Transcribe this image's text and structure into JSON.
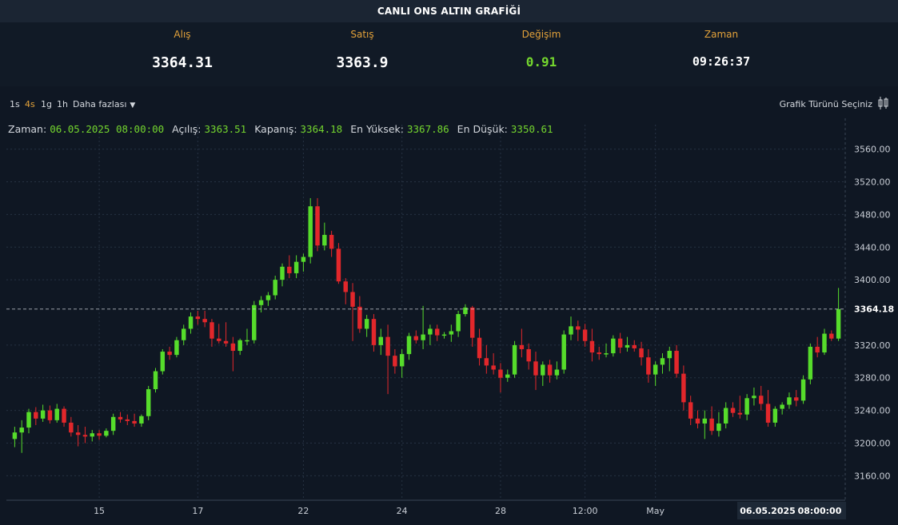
{
  "page": {
    "title": "CANLI ONS ALTIN GRAFİĞİ"
  },
  "quotes": {
    "bid_label": "Alış",
    "bid_value": "3364.31",
    "ask_label": "Satış",
    "ask_value": "3363.9",
    "change_label": "Değişim",
    "change_value": "0.91",
    "time_label": "Zaman",
    "time_value": "09:26:37"
  },
  "toolbar": {
    "timeframes": [
      "1s",
      "4s",
      "1g",
      "1h"
    ],
    "active_timeframe": "4s",
    "more_label": "Daha fazlası",
    "chart_type_label": "Grafik Türünü Seçiniz"
  },
  "ohlc": {
    "time_label": "Zaman:",
    "time_value": "06.05.2025 08:00:00",
    "open_label": "Açılış:",
    "open_value": "3363.51",
    "close_label": "Kapanış:",
    "close_value": "3364.18",
    "high_label": "En Yüksek:",
    "high_value": "3367.86",
    "low_label": "En Düşük:",
    "low_value": "3350.61"
  },
  "colors": {
    "up": "#56dc2b",
    "down": "#e2272b",
    "label_accent": "#e3a23a",
    "value_green": "#74d62e",
    "background": "#0f1723"
  },
  "chart_data": {
    "type": "candlestick",
    "y_ticks": [
      3160,
      3200,
      3240,
      3280,
      3320,
      3360,
      3400,
      3440,
      3480,
      3520,
      3560
    ],
    "y_tick_labels": [
      "3160.00",
      "3200.00",
      "3240.00",
      "3280.00",
      "3320.00",
      "3364.18",
      "3400.00",
      "3440.00",
      "3480.00",
      "3520.00",
      "3560.00"
    ],
    "ylim": [
      3130,
      3590
    ],
    "last_price": 3364.18,
    "last_price_label": "3364.18",
    "x_labels": [
      {
        "label": "15",
        "index": 12
      },
      {
        "label": "17",
        "index": 26
      },
      {
        "label": "22",
        "index": 41
      },
      {
        "label": "24",
        "index": 55
      },
      {
        "label": "28",
        "index": 69
      },
      {
        "label": "12:00",
        "index": 81
      },
      {
        "label": "May",
        "index": 91
      }
    ],
    "crosshair_date": "06.05.2025",
    "crosshair_time": "08:00:00",
    "grid": true,
    "candles": [
      {
        "o": 3205,
        "h": 3220,
        "l": 3195,
        "c": 3213
      },
      {
        "o": 3213,
        "h": 3228,
        "l": 3188,
        "c": 3219
      },
      {
        "o": 3219,
        "h": 3242,
        "l": 3212,
        "c": 3238
      },
      {
        "o": 3238,
        "h": 3244,
        "l": 3222,
        "c": 3230
      },
      {
        "o": 3230,
        "h": 3247,
        "l": 3226,
        "c": 3240
      },
      {
        "o": 3240,
        "h": 3246,
        "l": 3224,
        "c": 3228
      },
      {
        "o": 3228,
        "h": 3248,
        "l": 3225,
        "c": 3242
      },
      {
        "o": 3242,
        "h": 3245,
        "l": 3220,
        "c": 3225
      },
      {
        "o": 3225,
        "h": 3232,
        "l": 3208,
        "c": 3213
      },
      {
        "o": 3213,
        "h": 3222,
        "l": 3196,
        "c": 3210
      },
      {
        "o": 3210,
        "h": 3220,
        "l": 3200,
        "c": 3208
      },
      {
        "o": 3208,
        "h": 3216,
        "l": 3202,
        "c": 3212
      },
      {
        "o": 3212,
        "h": 3216,
        "l": 3204,
        "c": 3209
      },
      {
        "o": 3209,
        "h": 3218,
        "l": 3207,
        "c": 3215
      },
      {
        "o": 3215,
        "h": 3236,
        "l": 3210,
        "c": 3232
      },
      {
        "o": 3232,
        "h": 3238,
        "l": 3225,
        "c": 3229
      },
      {
        "o": 3229,
        "h": 3235,
        "l": 3222,
        "c": 3227
      },
      {
        "o": 3227,
        "h": 3236,
        "l": 3220,
        "c": 3224
      },
      {
        "o": 3224,
        "h": 3235,
        "l": 3220,
        "c": 3233
      },
      {
        "o": 3233,
        "h": 3270,
        "l": 3228,
        "c": 3266
      },
      {
        "o": 3266,
        "h": 3292,
        "l": 3262,
        "c": 3288
      },
      {
        "o": 3288,
        "h": 3315,
        "l": 3284,
        "c": 3312
      },
      {
        "o": 3312,
        "h": 3318,
        "l": 3302,
        "c": 3308
      },
      {
        "o": 3308,
        "h": 3330,
        "l": 3305,
        "c": 3326
      },
      {
        "o": 3326,
        "h": 3345,
        "l": 3320,
        "c": 3340
      },
      {
        "o": 3340,
        "h": 3360,
        "l": 3334,
        "c": 3355
      },
      {
        "o": 3355,
        "h": 3362,
        "l": 3345,
        "c": 3352
      },
      {
        "o": 3352,
        "h": 3362,
        "l": 3342,
        "c": 3348
      },
      {
        "o": 3348,
        "h": 3352,
        "l": 3318,
        "c": 3328
      },
      {
        "o": 3328,
        "h": 3346,
        "l": 3322,
        "c": 3325
      },
      {
        "o": 3325,
        "h": 3348,
        "l": 3318,
        "c": 3322
      },
      {
        "o": 3322,
        "h": 3330,
        "l": 3288,
        "c": 3313
      },
      {
        "o": 3313,
        "h": 3328,
        "l": 3308,
        "c": 3326
      },
      {
        "o": 3326,
        "h": 3340,
        "l": 3320,
        "c": 3326
      },
      {
        "o": 3326,
        "h": 3374,
        "l": 3322,
        "c": 3369
      },
      {
        "o": 3369,
        "h": 3380,
        "l": 3360,
        "c": 3375
      },
      {
        "o": 3375,
        "h": 3385,
        "l": 3368,
        "c": 3381
      },
      {
        "o": 3381,
        "h": 3405,
        "l": 3376,
        "c": 3400
      },
      {
        "o": 3400,
        "h": 3420,
        "l": 3392,
        "c": 3416
      },
      {
        "o": 3416,
        "h": 3430,
        "l": 3402,
        "c": 3408
      },
      {
        "o": 3408,
        "h": 3430,
        "l": 3402,
        "c": 3422
      },
      {
        "o": 3422,
        "h": 3432,
        "l": 3410,
        "c": 3428
      },
      {
        "o": 3428,
        "h": 3500,
        "l": 3420,
        "c": 3490
      },
      {
        "o": 3490,
        "h": 3500,
        "l": 3435,
        "c": 3442
      },
      {
        "o": 3442,
        "h": 3470,
        "l": 3436,
        "c": 3455
      },
      {
        "o": 3455,
        "h": 3460,
        "l": 3428,
        "c": 3438
      },
      {
        "o": 3438,
        "h": 3445,
        "l": 3395,
        "c": 3398
      },
      {
        "o": 3398,
        "h": 3402,
        "l": 3370,
        "c": 3385
      },
      {
        "o": 3385,
        "h": 3396,
        "l": 3325,
        "c": 3367
      },
      {
        "o": 3367,
        "h": 3380,
        "l": 3335,
        "c": 3340
      },
      {
        "o": 3340,
        "h": 3357,
        "l": 3330,
        "c": 3352
      },
      {
        "o": 3352,
        "h": 3358,
        "l": 3312,
        "c": 3320
      },
      {
        "o": 3320,
        "h": 3340,
        "l": 3308,
        "c": 3330
      },
      {
        "o": 3330,
        "h": 3345,
        "l": 3260,
        "c": 3307
      },
      {
        "o": 3307,
        "h": 3315,
        "l": 3285,
        "c": 3294
      },
      {
        "o": 3294,
        "h": 3315,
        "l": 3280,
        "c": 3309
      },
      {
        "o": 3309,
        "h": 3335,
        "l": 3302,
        "c": 3331
      },
      {
        "o": 3331,
        "h": 3338,
        "l": 3322,
        "c": 3326
      },
      {
        "o": 3326,
        "h": 3368,
        "l": 3315,
        "c": 3333
      },
      {
        "o": 3333,
        "h": 3345,
        "l": 3320,
        "c": 3340
      },
      {
        "o": 3340,
        "h": 3345,
        "l": 3325,
        "c": 3332
      },
      {
        "o": 3332,
        "h": 3336,
        "l": 3328,
        "c": 3333
      },
      {
        "o": 3333,
        "h": 3345,
        "l": 3324,
        "c": 3337
      },
      {
        "o": 3337,
        "h": 3362,
        "l": 3330,
        "c": 3358
      },
      {
        "o": 3358,
        "h": 3370,
        "l": 3355,
        "c": 3366
      },
      {
        "o": 3366,
        "h": 3368,
        "l": 3318,
        "c": 3329
      },
      {
        "o": 3329,
        "h": 3340,
        "l": 3295,
        "c": 3304
      },
      {
        "o": 3304,
        "h": 3320,
        "l": 3285,
        "c": 3295
      },
      {
        "o": 3295,
        "h": 3310,
        "l": 3284,
        "c": 3290
      },
      {
        "o": 3290,
        "h": 3298,
        "l": 3262,
        "c": 3280
      },
      {
        "o": 3280,
        "h": 3290,
        "l": 3275,
        "c": 3284
      },
      {
        "o": 3284,
        "h": 3325,
        "l": 3280,
        "c": 3320
      },
      {
        "o": 3320,
        "h": 3340,
        "l": 3305,
        "c": 3315
      },
      {
        "o": 3315,
        "h": 3322,
        "l": 3290,
        "c": 3300
      },
      {
        "o": 3300,
        "h": 3312,
        "l": 3265,
        "c": 3283
      },
      {
        "o": 3283,
        "h": 3300,
        "l": 3270,
        "c": 3296
      },
      {
        "o": 3296,
        "h": 3302,
        "l": 3274,
        "c": 3283
      },
      {
        "o": 3283,
        "h": 3300,
        "l": 3278,
        "c": 3290
      },
      {
        "o": 3290,
        "h": 3338,
        "l": 3285,
        "c": 3333
      },
      {
        "o": 3333,
        "h": 3355,
        "l": 3326,
        "c": 3343
      },
      {
        "o": 3343,
        "h": 3350,
        "l": 3325,
        "c": 3339
      },
      {
        "o": 3339,
        "h": 3346,
        "l": 3318,
        "c": 3325
      },
      {
        "o": 3325,
        "h": 3340,
        "l": 3300,
        "c": 3311
      },
      {
        "o": 3311,
        "h": 3318,
        "l": 3302,
        "c": 3309
      },
      {
        "o": 3309,
        "h": 3322,
        "l": 3305,
        "c": 3310
      },
      {
        "o": 3310,
        "h": 3332,
        "l": 3306,
        "c": 3328
      },
      {
        "o": 3328,
        "h": 3335,
        "l": 3310,
        "c": 3317
      },
      {
        "o": 3317,
        "h": 3330,
        "l": 3312,
        "c": 3320
      },
      {
        "o": 3320,
        "h": 3326,
        "l": 3312,
        "c": 3316
      },
      {
        "o": 3316,
        "h": 3324,
        "l": 3295,
        "c": 3305
      },
      {
        "o": 3305,
        "h": 3315,
        "l": 3274,
        "c": 3284
      },
      {
        "o": 3284,
        "h": 3300,
        "l": 3270,
        "c": 3296
      },
      {
        "o": 3296,
        "h": 3310,
        "l": 3285,
        "c": 3304
      },
      {
        "o": 3304,
        "h": 3318,
        "l": 3288,
        "c": 3313
      },
      {
        "o": 3313,
        "h": 3320,
        "l": 3280,
        "c": 3285
      },
      {
        "o": 3285,
        "h": 3295,
        "l": 3240,
        "c": 3250
      },
      {
        "o": 3250,
        "h": 3258,
        "l": 3222,
        "c": 3230
      },
      {
        "o": 3230,
        "h": 3240,
        "l": 3218,
        "c": 3224
      },
      {
        "o": 3224,
        "h": 3240,
        "l": 3205,
        "c": 3230
      },
      {
        "o": 3230,
        "h": 3245,
        "l": 3210,
        "c": 3215
      },
      {
        "o": 3215,
        "h": 3238,
        "l": 3208,
        "c": 3224
      },
      {
        "o": 3224,
        "h": 3250,
        "l": 3218,
        "c": 3243
      },
      {
        "o": 3243,
        "h": 3250,
        "l": 3232,
        "c": 3237
      },
      {
        "o": 3237,
        "h": 3258,
        "l": 3230,
        "c": 3235
      },
      {
        "o": 3235,
        "h": 3260,
        "l": 3228,
        "c": 3255
      },
      {
        "o": 3255,
        "h": 3268,
        "l": 3246,
        "c": 3258
      },
      {
        "o": 3258,
        "h": 3270,
        "l": 3240,
        "c": 3248
      },
      {
        "o": 3248,
        "h": 3265,
        "l": 3220,
        "c": 3225
      },
      {
        "o": 3225,
        "h": 3245,
        "l": 3220,
        "c": 3242
      },
      {
        "o": 3242,
        "h": 3250,
        "l": 3235,
        "c": 3247
      },
      {
        "o": 3247,
        "h": 3262,
        "l": 3242,
        "c": 3256
      },
      {
        "o": 3256,
        "h": 3265,
        "l": 3245,
        "c": 3252
      },
      {
        "o": 3252,
        "h": 3283,
        "l": 3248,
        "c": 3278
      },
      {
        "o": 3278,
        "h": 3322,
        "l": 3272,
        "c": 3318
      },
      {
        "o": 3318,
        "h": 3330,
        "l": 3305,
        "c": 3311
      },
      {
        "o": 3311,
        "h": 3340,
        "l": 3308,
        "c": 3334
      },
      {
        "o": 3334,
        "h": 3338,
        "l": 3325,
        "c": 3328
      },
      {
        "o": 3328,
        "h": 3390,
        "l": 3325,
        "c": 3364
      }
    ]
  }
}
